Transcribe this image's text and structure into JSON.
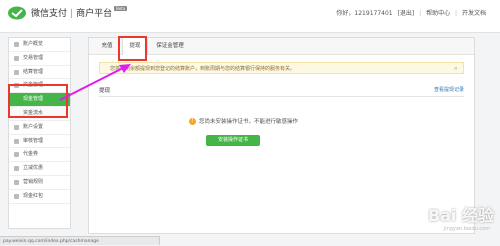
{
  "header": {
    "brand_name": "微信支付",
    "brand_sep": "|",
    "brand_platform": "商户平台",
    "beta_badge": "Beta",
    "user_greeting": "你好，1219177401",
    "logout": "[退出]",
    "help_center": "帮助中心",
    "dev_docs": "开发文档"
  },
  "sidebar": {
    "items": [
      {
        "label": "账户概览"
      },
      {
        "label": "交易管理"
      },
      {
        "label": "结算管理"
      },
      {
        "label": "资金管理"
      },
      {
        "label": "现金管理"
      },
      {
        "label": "资金流水"
      },
      {
        "label": "账户设置"
      },
      {
        "label": "审核管理"
      },
      {
        "label": "代金券"
      },
      {
        "label": "立减优惠"
      },
      {
        "label": "营销规则"
      },
      {
        "label": "现金红包"
      }
    ]
  },
  "tabs": [
    {
      "label": "充值"
    },
    {
      "label": "提现"
    },
    {
      "label": "保证金管理"
    }
  ],
  "notice": {
    "text": "您将可用余额提现到您登记的结算账户，到账周期与您的结算银行保持的服务有关。",
    "close": "×"
  },
  "section": {
    "title": "提现",
    "link": "查看提现记录"
  },
  "warning": {
    "icon": "!",
    "text": "您尚未安装操作证书，不能进行敏感操作"
  },
  "install_button": "安装操作证书",
  "status_url": "pay.weixin.qq.com/index.php/cashmanage",
  "watermark": "Bai 经验",
  "watermark_sub": "jingyan.baidu.com",
  "colors": {
    "accent": "#44b549",
    "highlight_red": "#e8392f",
    "arrow_magenta": "#e01cf0",
    "warning": "#f5a623"
  }
}
